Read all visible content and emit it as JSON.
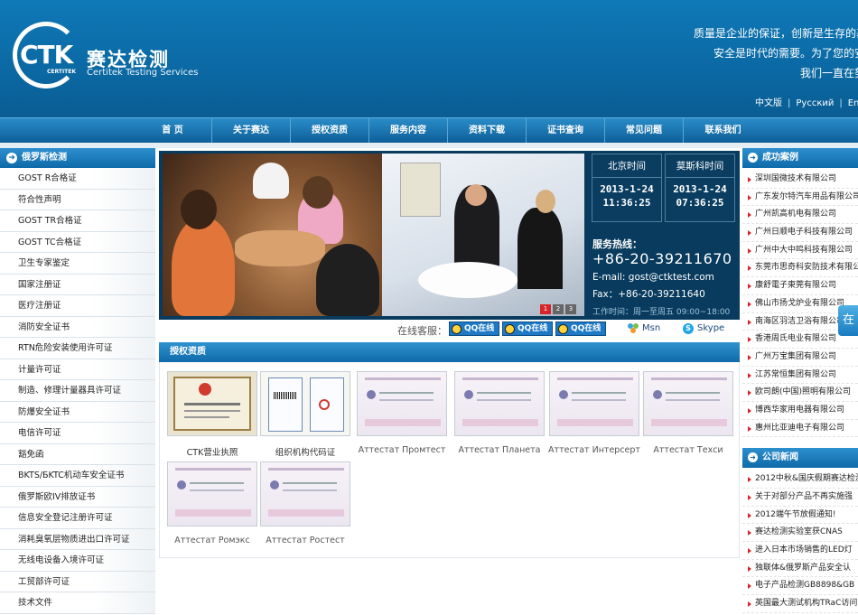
{
  "header": {
    "logo_ctk": "CTK",
    "logo_certitek": "CERTITEK",
    "logo_cn": "赛达检测",
    "logo_en": "Certitek Testing Services",
    "slogans": [
      "质量是企业的保证，创新是生存的基",
      "安全是时代的需要。为了您的安",
      "我们一直在努"
    ],
    "languages": [
      "中文版",
      "Русский",
      "En"
    ]
  },
  "nav": {
    "items": [
      "首 页",
      "关于赛达",
      "授权资质",
      "服务内容",
      "资料下载",
      "证书查询",
      "常见问题",
      "联系我们"
    ]
  },
  "left": {
    "heading": "俄罗斯检测",
    "items": [
      "GOST R合格证",
      "符合性声明",
      "GOST TR合格证",
      "GOST TC合格证",
      "卫生专家鉴定",
      "国家注册证",
      "医疗注册证",
      "消防安全证书",
      "RTN危险安装使用许可证",
      "计量许可证",
      "制造、修理计量器具许可证",
      "防爆安全证书",
      "电信许可证",
      "豁免函",
      "BKTS/БKTC机动车安全证书",
      "俄罗斯欧IV排放证书",
      "信息安全登记注册许可证",
      "消耗臭氧层物质进出口许可证",
      "无线电设备入境许可证",
      "工贸部许可证",
      "技术文件"
    ]
  },
  "banner": {
    "clocks": [
      {
        "label": "北京时间",
        "date": "2013-1-24",
        "time": "11:36:25"
      },
      {
        "label": "莫斯科时间",
        "date": "2013-1-24",
        "time": "07:36:25"
      }
    ],
    "hotline_label": "服务热线：",
    "hotline": "+86-20-39211670",
    "email": "E-mail: gost@ctktest.com",
    "fax": "Fax：+86-20-39211640",
    "hours": "工作时间：周一至周五 09:00~18:00",
    "pager": [
      "1",
      "2",
      "3"
    ]
  },
  "online": {
    "label": "在线客服：",
    "qq": [
      "QQ在线",
      "QQ在线",
      "QQ在线"
    ],
    "msn": "Msn",
    "skype": "Skype"
  },
  "auth": {
    "heading": "授权资质",
    "certs": [
      "CTK营业执照",
      "组织机构代码证",
      "Аттестат Промтест",
      "Аттестат Планета",
      "Аттестат Интерсерт",
      "Аттестат Техси",
      "Аттестат Ромэкс",
      "Аттестат Ростест"
    ]
  },
  "right": {
    "cases_heading": "成功案例",
    "cases": [
      "深圳国微技术有限公司",
      "广东发尔特汽车用品有限公司",
      "广州凯高机电有限公司",
      "广州日顺电子科技有限公司",
      "广州中大中鸣科技有限公司",
      "东莞市思奇科安防技术有限公司",
      "康舒電子東莞有限公司",
      "佛山市扬戈炉业有限公司",
      "南海区羽洁卫浴有限公司",
      "香港周氏电业有限公司",
      "广州万宝集团有限公司",
      "江苏常恒集团有限公司",
      "欧司朗(中国)照明有限公司",
      "博西华家用电器有限公司",
      "惠州比亚迪电子有限公司"
    ],
    "news_heading": "公司新闻",
    "news": [
      "2012中秋&国庆假期赛达检测",
      "关于对部分产品不再实施强",
      "2012端午节放假通知!",
      "赛达检测实验室获CNAS",
      "进入日本市场销售的LED灯",
      "独联体&俄罗斯产品安全认",
      "电子产品检测GB8898&GB",
      "英国最大测试机构TRaC访问"
    ]
  },
  "float_tab": "在"
}
